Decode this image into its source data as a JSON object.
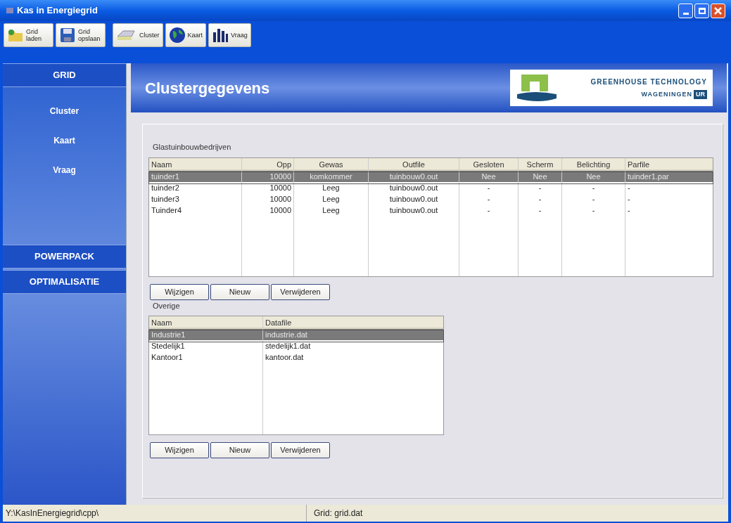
{
  "window": {
    "title": "Kas in Energiegrid"
  },
  "toolbar": [
    {
      "label": "Grid laden"
    },
    {
      "label": "Grid opslaan"
    },
    {
      "label": "Cluster"
    },
    {
      "label": "Kaart"
    },
    {
      "label": "Vraag"
    }
  ],
  "sidebar": {
    "sections": [
      {
        "title": "GRID",
        "items": [
          "Cluster",
          "Kaart",
          "Vraag"
        ]
      },
      {
        "title": "POWERPACK"
      },
      {
        "title": "OPTIMALISATIE"
      }
    ]
  },
  "header": {
    "title": "Clustergegevens",
    "logo": {
      "line1": "GREENHOUSE TECHNOLOGY",
      "line2": "WAGENINGEN",
      "badge": "UR"
    }
  },
  "groups": [
    {
      "label": "Glastuinbouwbedrijven",
      "columns": [
        "Naam",
        "Opp",
        "Gewas",
        "Outfile",
        "Gesloten",
        "Scherm",
        "Belichting",
        "Parfile"
      ],
      "rows": [
        {
          "cells": [
            "tuinder1",
            "10000",
            "komkommer",
            "tuinbouw0.out",
            "Nee",
            "Nee",
            "Nee",
            "tuinder1.par"
          ],
          "selected": true
        },
        {
          "cells": [
            "tuinder2",
            "10000",
            "Leeg",
            "tuinbouw0.out",
            "-",
            "-",
            "-",
            "-"
          ],
          "selected": false
        },
        {
          "cells": [
            "tuinder3",
            "10000",
            "Leeg",
            "tuinbouw0.out",
            "-",
            "-",
            "-",
            "-"
          ],
          "selected": false
        },
        {
          "cells": [
            "Tuinder4",
            "10000",
            "Leeg",
            "tuinbouw0.out",
            "-",
            "-",
            "-",
            "-"
          ],
          "selected": false
        }
      ],
      "buttons": [
        "Wijzigen",
        "Nieuw",
        "Verwijderen"
      ]
    },
    {
      "label": "Overige",
      "columns": [
        "Naam",
        "Datafile"
      ],
      "rows": [
        {
          "cells": [
            "Industrie1",
            "industrie.dat"
          ],
          "selected": true
        },
        {
          "cells": [
            "Stedelijk1",
            "stedelijk1.dat"
          ],
          "selected": false
        },
        {
          "cells": [
            "Kantoor1",
            "kantoor.dat"
          ],
          "selected": false
        }
      ],
      "buttons": [
        "Wijzigen",
        "Nieuw",
        "Verwijderen"
      ]
    }
  ],
  "status_bar": [
    "Y:\\KasInEnergiegrid\\cpp\\",
    "Grid: grid.dat"
  ]
}
